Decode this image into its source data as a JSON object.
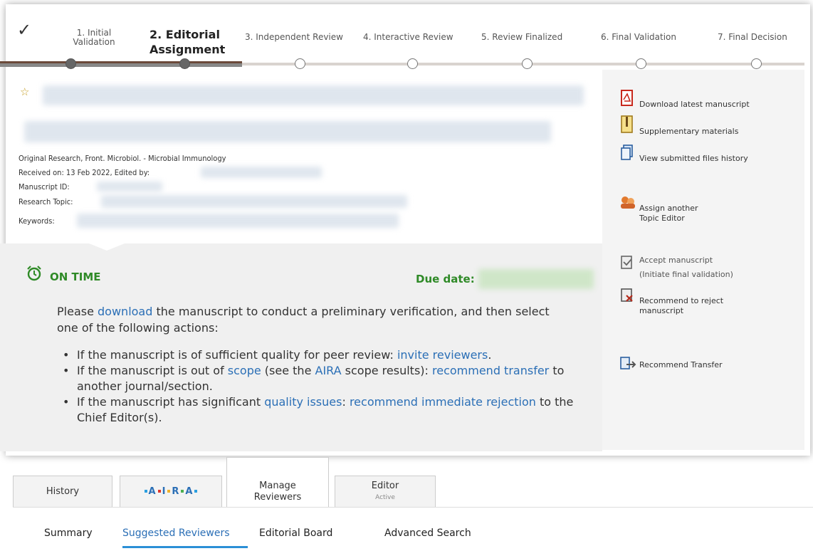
{
  "steps": [
    {
      "label": "1. Initial\nValidation",
      "state": "done"
    },
    {
      "label": "2. Editorial\nAssignment",
      "state": "current"
    },
    {
      "label": "3. Independent Review",
      "state": "pending"
    },
    {
      "label": "4. Interactive Review",
      "state": "pending"
    },
    {
      "label": "5. Review Finalized",
      "state": "pending"
    },
    {
      "label": "6. Final Validation",
      "state": "pending"
    },
    {
      "label": "7. Final Decision",
      "state": "pending"
    }
  ],
  "article": {
    "type_line": "Original Research, Front. Microbiol. - Microbial Immunology",
    "received_label": "Received on: 13 Feb 2022, Edited by:",
    "manuscript_id_label": "Manuscript ID:",
    "research_topic_label": "Research Topic:",
    "keywords_label": "Keywords:"
  },
  "actions": [
    {
      "icon": "pdf-icon",
      "label": "Download latest manuscript"
    },
    {
      "icon": "zip-icon",
      "label": "Supplementary materials"
    },
    {
      "icon": "files-history-icon",
      "label": "View submitted files history"
    },
    {
      "icon": "assign-editor-icon",
      "label": "Assign another\nTopic Editor"
    },
    {
      "icon": "accept-icon",
      "label": "Accept manuscript\n(Initiate final validation)"
    },
    {
      "icon": "reject-icon",
      "label": "Recommend to reject\nmanuscript"
    },
    {
      "icon": "transfer-icon",
      "label": "Recommend Transfer"
    }
  ],
  "status": {
    "label": "ON TIME",
    "due_label": "Due date:",
    "intro_before": "Please ",
    "intro_link": "download",
    "intro_after": " the manuscript to conduct a preliminary verification, and then select one of the following actions:",
    "b1_text": "If the manuscript is of sufficient quality for peer review: ",
    "b1_link": "invite reviewers",
    "b1_end": ".",
    "b2_text1": "If the manuscript is out of ",
    "b2_link1": "scope",
    "b2_text2": " (see the ",
    "b2_link2": "AIRA",
    "b2_text3": " scope results): ",
    "b2_link3": "recommend transfer",
    "b2_text4": " to another journal/section.",
    "b3_text1": "If the manuscript has significant ",
    "b3_link1": "quality issues",
    "b3_text2": ": ",
    "b3_link2": "recommend immediate rejection",
    "b3_text3": " to the Chief Editor(s)."
  },
  "tabs": {
    "history": "History",
    "aira_letters": [
      "A",
      "I",
      "R",
      "A"
    ],
    "manage_reviewers": "Manage\nReviewers",
    "editor": "Editor",
    "editor_status": "Active"
  },
  "subnav": {
    "summary": "Summary",
    "suggested": "Suggested Reviewers",
    "board": "Editorial Board",
    "advanced": "Advanced Search"
  },
  "colors": {
    "accent": "#2b6fb6",
    "ontime": "#2f8a27"
  }
}
